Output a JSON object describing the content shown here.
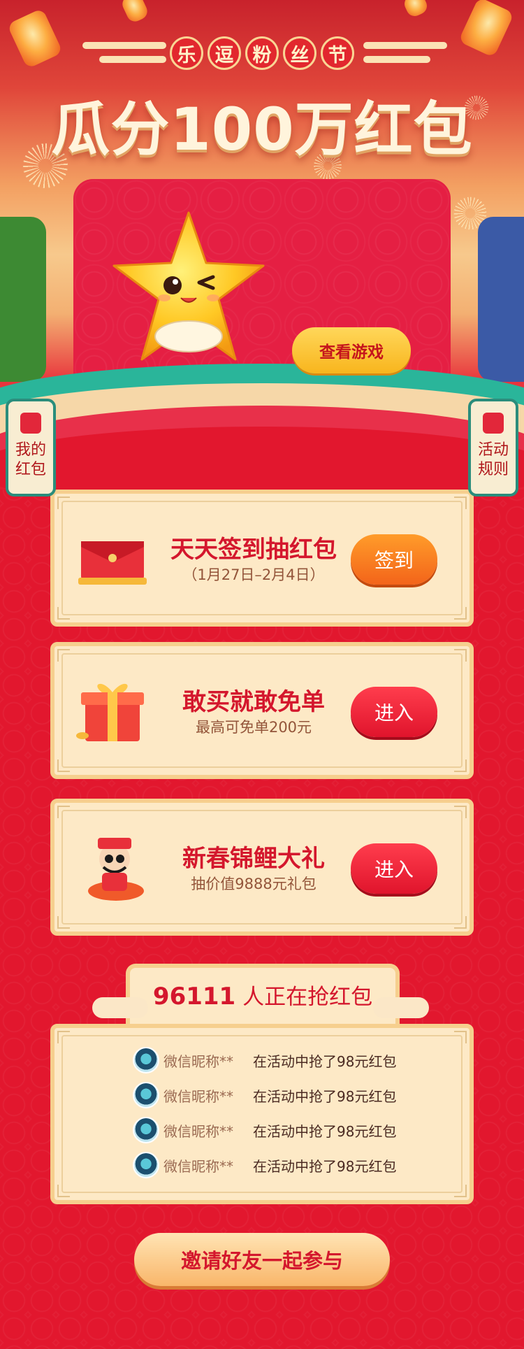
{
  "header": {
    "festival_chars": [
      "乐",
      "逗",
      "粉",
      "丝",
      "节"
    ],
    "title": "瓜分100万红包"
  },
  "game_card": {
    "button_label": "查看游戏"
  },
  "side_buttons": {
    "left": {
      "label": "我的红包"
    },
    "right": {
      "label": "活动规则"
    }
  },
  "tasks": [
    {
      "title": "天天签到抽红包",
      "subtitle": "（1月27日–2月4日）",
      "button_label": "签到",
      "icon": "red-envelope-icon"
    },
    {
      "title": "敢买就敢免单",
      "subtitle": "最高可免单200元",
      "button_label": "进入",
      "icon": "gift-box-icon"
    },
    {
      "title": "新春锦鲤大礼",
      "subtitle": "抽价值9888元礼包",
      "button_label": "进入",
      "icon": "fortune-god-icon"
    }
  ],
  "ticker": {
    "count": "96111",
    "count_suffix": "人正在抢红包",
    "rows": [
      {
        "nickname": "微信昵称**",
        "message": "在活动中抢了98元红包"
      },
      {
        "nickname": "微信昵称**",
        "message": "在活动中抢了98元红包"
      },
      {
        "nickname": "微信昵称**",
        "message": "在活动中抢了98元红包"
      },
      {
        "nickname": "微信昵称**",
        "message": "在活动中抢了98元红包"
      }
    ]
  },
  "invite_button": "邀请好友一起参与",
  "colors": {
    "primary_red": "#e2172e",
    "title_cream": "#fff4dc",
    "card_cream": "#fde9c6",
    "button_orange": "#f3641a",
    "button_red": "#e0142c",
    "accent_teal": "#2a8d7c"
  }
}
